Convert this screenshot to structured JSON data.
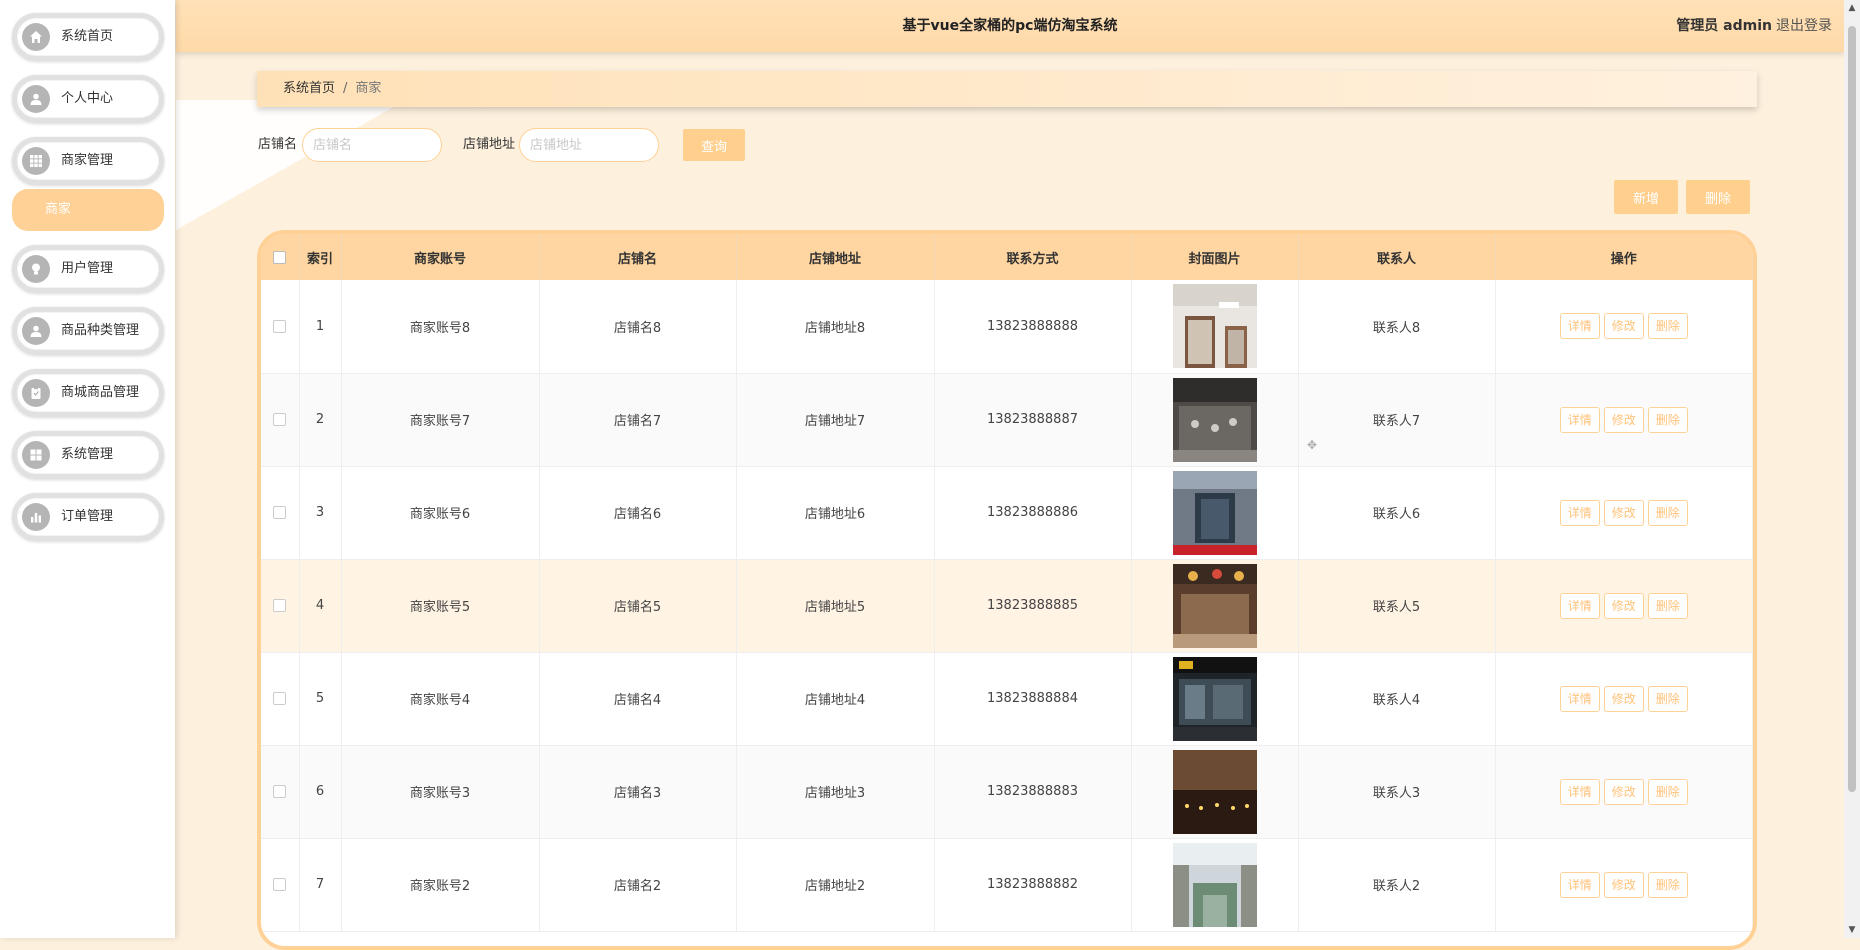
{
  "header": {
    "site_title": "基于vue全家桶的pc端仿淘宝系统",
    "admin_label": "管理员",
    "admin_name": "admin",
    "logout": "退出登录"
  },
  "sidebar": {
    "items": [
      {
        "label": "系统首页",
        "icon": "home-icon"
      },
      {
        "label": "个人中心",
        "icon": "user-icon"
      },
      {
        "label": "商家管理",
        "icon": "grid-icon",
        "sub": "商家"
      },
      {
        "label": "用户管理",
        "icon": "bulb-icon"
      },
      {
        "label": "商品种类管理",
        "icon": "person-icon"
      },
      {
        "label": "商城商品管理",
        "icon": "clipboard-icon"
      },
      {
        "label": "系统管理",
        "icon": "grid-icon"
      },
      {
        "label": "订单管理",
        "icon": "bar-chart-icon"
      }
    ]
  },
  "breadcrumb": {
    "home": "系统首页",
    "separator": "/",
    "current": "商家"
  },
  "search": {
    "shop_name_label": "店铺名",
    "shop_name_placeholder": "店铺名",
    "shop_addr_label": "店铺地址",
    "shop_addr_placeholder": "店铺地址",
    "query_button": "查询"
  },
  "actions": {
    "add": "新增",
    "delete": "删除"
  },
  "table": {
    "headers": [
      "索引",
      "商家账号",
      "店铺名",
      "店铺地址",
      "联系方式",
      "封面图片",
      "联系人",
      "操作"
    ],
    "op_labels": {
      "detail": "详情",
      "edit": "修改",
      "delete": "删除"
    },
    "rows": [
      {
        "index": "1",
        "account": "商家账号8",
        "shop": "店铺名8",
        "address": "店铺地址8",
        "phone": "13823888888",
        "contact": "联系人8"
      },
      {
        "index": "2",
        "account": "商家账号7",
        "shop": "店铺名7",
        "address": "店铺地址7",
        "phone": "13823888887",
        "contact": "联系人7"
      },
      {
        "index": "3",
        "account": "商家账号6",
        "shop": "店铺名6",
        "address": "店铺地址6",
        "phone": "13823888886",
        "contact": "联系人6"
      },
      {
        "index": "4",
        "account": "商家账号5",
        "shop": "店铺名5",
        "address": "店铺地址5",
        "phone": "13823888885",
        "contact": "联系人5"
      },
      {
        "index": "5",
        "account": "商家账号4",
        "shop": "店铺名4",
        "address": "店铺地址4",
        "phone": "13823888884",
        "contact": "联系人4"
      },
      {
        "index": "6",
        "account": "商家账号3",
        "shop": "店铺名3",
        "address": "店铺地址3",
        "phone": "13823888883",
        "contact": "联系人3"
      },
      {
        "index": "7",
        "account": "商家账号2",
        "shop": "店铺名2",
        "address": "店铺地址2",
        "phone": "13823888882",
        "contact": "联系人2"
      }
    ]
  },
  "colors": {
    "accent": "#ffd196",
    "header_bg": "#ffd6a1",
    "page_bg": "#fdf0dd"
  }
}
